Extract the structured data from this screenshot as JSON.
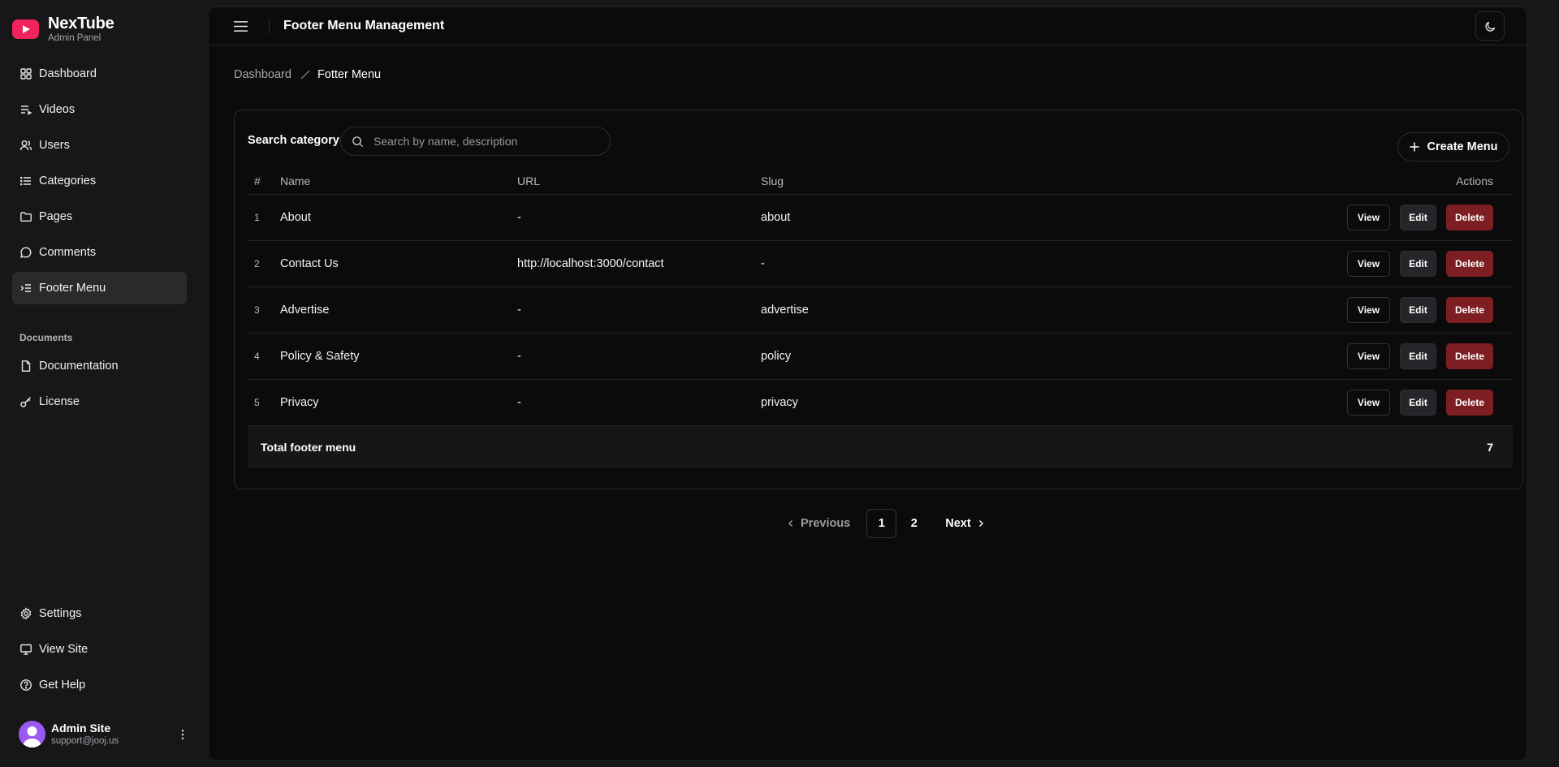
{
  "brand": {
    "name": "NexTube",
    "subtitle": "Admin Panel",
    "accent": "#f0235a"
  },
  "sidebar": {
    "main_items": [
      {
        "label": "Dashboard",
        "icon": "dashboard-grid-icon"
      },
      {
        "label": "Videos",
        "icon": "playlist-icon"
      },
      {
        "label": "Users",
        "icon": "users-icon"
      },
      {
        "label": "Categories",
        "icon": "list-icon"
      },
      {
        "label": "Pages",
        "icon": "folder-icon"
      },
      {
        "label": "Comments",
        "icon": "comment-icon"
      },
      {
        "label": "Footer Menu",
        "icon": "menu-indent-icon",
        "active": true
      }
    ],
    "section_label": "Documents",
    "doc_items": [
      {
        "label": "Documentation",
        "icon": "file-icon"
      },
      {
        "label": "License",
        "icon": "key-icon"
      }
    ],
    "bottom_items": [
      {
        "label": "Settings",
        "icon": "gear-icon"
      },
      {
        "label": "View Site",
        "icon": "monitor-icon"
      },
      {
        "label": "Get Help",
        "icon": "help-circle-icon"
      }
    ],
    "user": {
      "name": "Admin Site",
      "email": "support@jooj.us"
    }
  },
  "header": {
    "title": "Footer Menu Management"
  },
  "breadcrumb": {
    "root": "Dashboard",
    "current": "Fotter Menu"
  },
  "search": {
    "label": "Search category",
    "placeholder": "Search by name, description",
    "value": ""
  },
  "create_button": {
    "label": "Create Menu"
  },
  "table": {
    "columns": [
      "#",
      "Name",
      "URL",
      "Slug",
      "Actions"
    ],
    "rows": [
      {
        "num": "1",
        "name": "About",
        "url": "-",
        "slug": "about"
      },
      {
        "num": "2",
        "name": "Contact Us",
        "url": "http://localhost:3000/contact",
        "slug": "-"
      },
      {
        "num": "3",
        "name": "Advertise",
        "url": "-",
        "slug": "advertise"
      },
      {
        "num": "4",
        "name": "Policy & Safety",
        "url": "-",
        "slug": "policy"
      },
      {
        "num": "5",
        "name": "Privacy",
        "url": "-",
        "slug": "privacy"
      }
    ],
    "actions": {
      "view": "View",
      "edit": "Edit",
      "delete": "Delete"
    },
    "total_label": "Total footer menu",
    "total_value": "7"
  },
  "pagination": {
    "previous": "Previous",
    "pages": [
      "1",
      "2"
    ],
    "current": "1",
    "next": "Next"
  },
  "colors": {
    "delete": "#7d1f22",
    "avatar": "#9b59f0"
  }
}
